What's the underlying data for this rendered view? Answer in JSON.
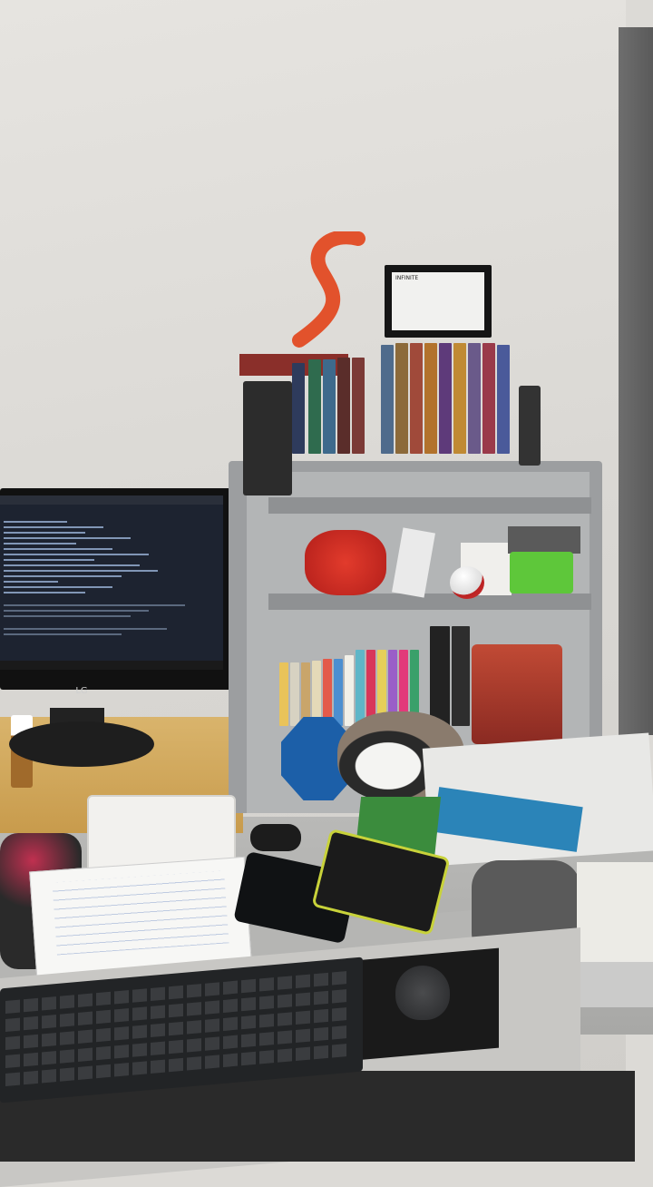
{
  "scene": {
    "description_kind": "photo",
    "monitor_brand": "LG",
    "plaque_heading": "INFINITE"
  },
  "colors": {
    "wall": "#dedcd8",
    "desk": "#b5b5b3",
    "shelf": "#9c9ea0",
    "accent_orange": "#e2522c",
    "green_box": "#5ec73a"
  },
  "icons": [
    "monitor-icon",
    "keyboard-icon",
    "mouse-icon"
  ]
}
